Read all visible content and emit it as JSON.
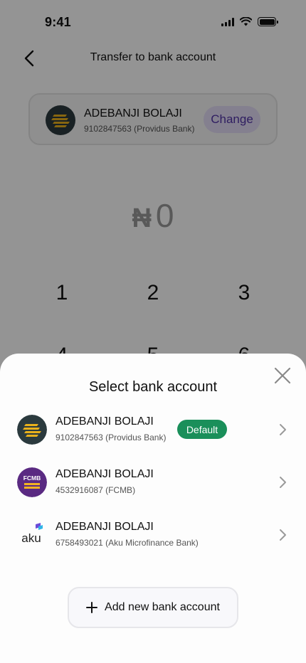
{
  "status_bar": {
    "time": "9:41"
  },
  "header": {
    "title": "Transfer to bank account"
  },
  "recipient": {
    "name": "ADEBANJI BOLAJI",
    "account": "9102847563 (Providus Bank)",
    "change_label": "Change"
  },
  "amount": {
    "currency": "₦",
    "value": "0"
  },
  "keypad": {
    "keys": [
      "1",
      "2",
      "3",
      "4",
      "5",
      "6"
    ]
  },
  "sheet": {
    "title": "Select bank account",
    "accounts": [
      {
        "name": "ADEBANJI BOLAJI",
        "details": "9102847563 (Providus Bank)",
        "badge": "Default",
        "logo": "providus-logo"
      },
      {
        "name": "ADEBANJI BOLAJI",
        "details": "4532916087 (FCMB)",
        "logo": "fcmb-logo",
        "logo_text": "FCMB"
      },
      {
        "name": "ADEBANJI BOLAJI",
        "details": "6758493021 (Aku Microfinance Bank)",
        "logo": "aku-logo",
        "logo_text": "aku"
      }
    ],
    "add_label": "Add new bank account"
  },
  "colors": {
    "accent": "#5234a8",
    "accent_bg": "#e4dcf7",
    "default_badge": "#1a8f5a",
    "providus_dark": "#2b3a3e",
    "providus_gold": "#e8b01c",
    "fcmb_purple": "#5a2a82",
    "aku_purple": "#6b4bd8"
  }
}
